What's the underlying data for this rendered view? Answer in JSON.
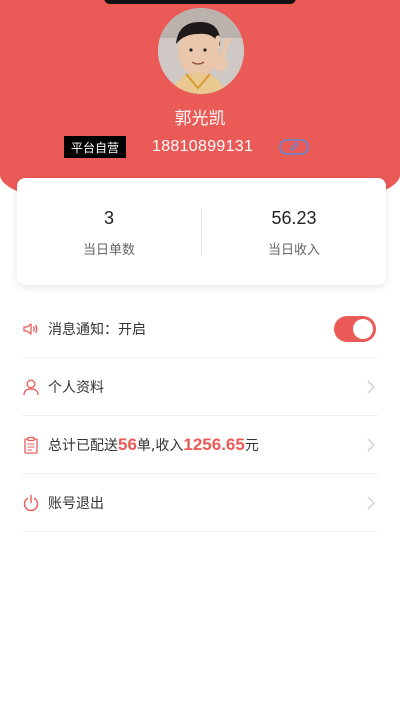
{
  "profile": {
    "name": "郭光凯",
    "tag": "平台自营",
    "phone": "18810899131"
  },
  "stats": {
    "orders_value": "3",
    "orders_label": "当日单数",
    "income_value": "56.23",
    "income_label": "当日收入"
  },
  "menu": {
    "notify_label": "消息通知：开启",
    "notify_on": true,
    "profile_label": "个人资料",
    "summary_prefix": "总计已配送",
    "summary_orders": "56",
    "summary_mid": "单,收入",
    "summary_income": "1256.65",
    "summary_suffix": "元",
    "logout_label": "账号退出"
  },
  "icons": {
    "speaker": "speaker-icon",
    "person": "person-icon",
    "clipboard": "clipboard-icon",
    "power": "power-icon",
    "chevron": "chevron-right-icon",
    "edit": "edit-icon"
  },
  "colors": {
    "accent": "#ea5a57",
    "tag_bg": "#000000",
    "edit_icon": "#5b8fd6"
  }
}
